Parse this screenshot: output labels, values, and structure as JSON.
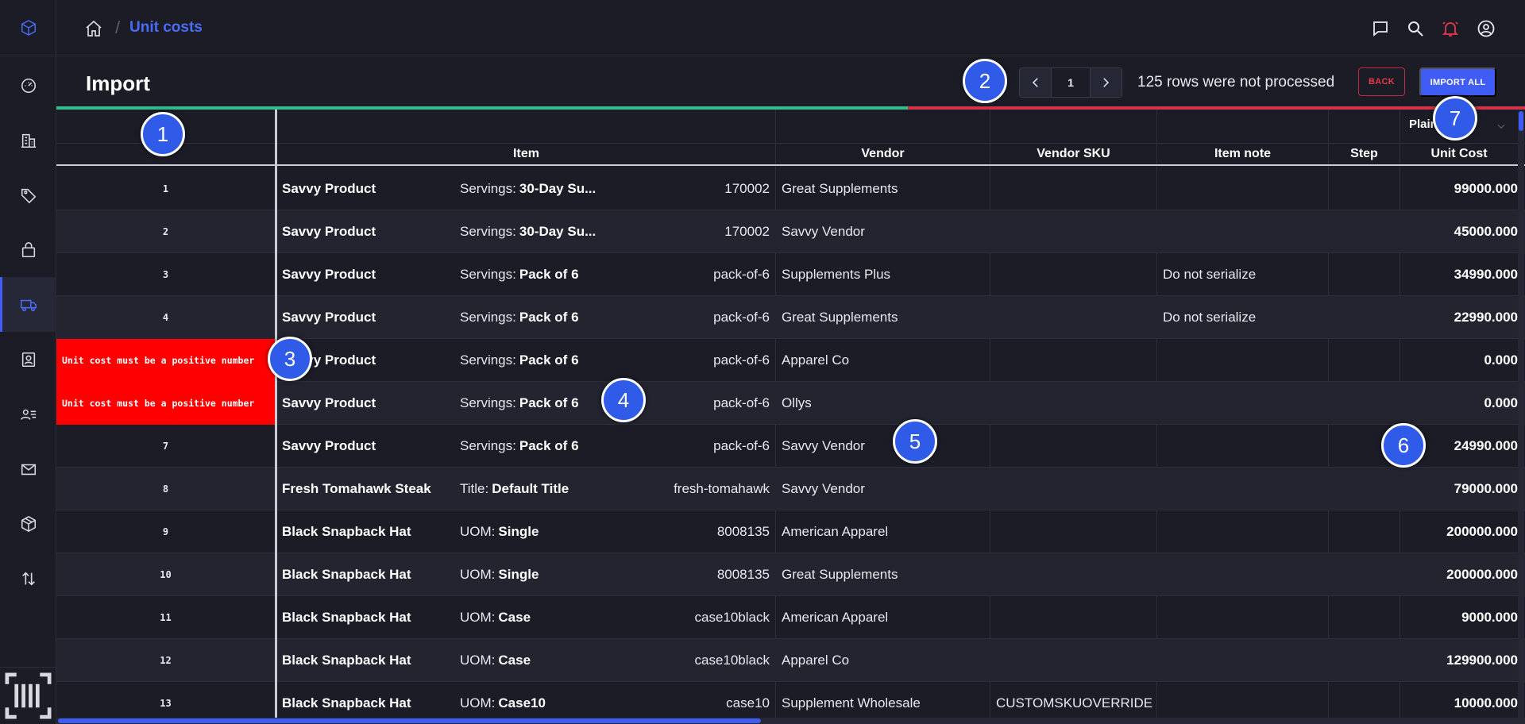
{
  "breadcrumb": {
    "current": "Unit costs",
    "separator": "/"
  },
  "header": {
    "title": "Import",
    "page_number": "1",
    "rows_message": "125 rows were not processed",
    "back_label": "BACK",
    "import_all_label": "IMPORT ALL",
    "progress_fraction": 0.58
  },
  "table": {
    "price_mode": "Plain",
    "columns": {
      "item": "Item",
      "vendor": "Vendor",
      "vendor_sku": "Vendor SKU",
      "item_note": "Item note",
      "step": "Step",
      "unit_cost": "Unit Cost"
    },
    "rows": [
      {
        "num": "1",
        "error": "",
        "name": "Savvy Product",
        "opt_label": "Servings:",
        "opt_value": "30-Day Su...",
        "sku": "170002",
        "vendor": "Great Supplements",
        "vendor_sku": "",
        "note": "",
        "cost": "99000.000"
      },
      {
        "num": "2",
        "error": "",
        "name": "Savvy Product",
        "opt_label": "Servings:",
        "opt_value": "30-Day Su...",
        "sku": "170002",
        "vendor": "Savvy Vendor",
        "vendor_sku": "",
        "note": "",
        "cost": "45000.000"
      },
      {
        "num": "3",
        "error": "",
        "name": "Savvy Product",
        "opt_label": "Servings:",
        "opt_value": "Pack of 6",
        "sku": "pack-of-6",
        "vendor": "Supplements Plus",
        "vendor_sku": "",
        "note": "Do not serialize",
        "cost": "34990.000"
      },
      {
        "num": "4",
        "error": "",
        "name": "Savvy Product",
        "opt_label": "Servings:",
        "opt_value": "Pack of 6",
        "sku": "pack-of-6",
        "vendor": "Great Supplements",
        "vendor_sku": "",
        "note": "Do not serialize",
        "cost": "22990.000"
      },
      {
        "num": "",
        "error": "Unit cost must be a positive number",
        "name": "Savvy Product",
        "opt_label": "Servings:",
        "opt_value": "Pack of 6",
        "sku": "pack-of-6",
        "vendor": "Apparel Co",
        "vendor_sku": "",
        "note": "",
        "cost": "0.000"
      },
      {
        "num": "",
        "error": "Unit cost must be a positive number",
        "name": "Savvy Product",
        "opt_label": "Servings:",
        "opt_value": "Pack of 6",
        "sku": "pack-of-6",
        "vendor": "Ollys",
        "vendor_sku": "",
        "note": "",
        "cost": "0.000"
      },
      {
        "num": "7",
        "error": "",
        "name": "Savvy Product",
        "opt_label": "Servings:",
        "opt_value": "Pack of 6",
        "sku": "pack-of-6",
        "vendor": "Savvy Vendor",
        "vendor_sku": "",
        "note": "",
        "cost": "24990.000"
      },
      {
        "num": "8",
        "error": "",
        "name": "Fresh Tomahawk Steak",
        "opt_label": "Title:",
        "opt_value": "Default Title",
        "sku": "fresh-tomahawk",
        "vendor": "Savvy Vendor",
        "vendor_sku": "",
        "note": "",
        "cost": "79000.000"
      },
      {
        "num": "9",
        "error": "",
        "name": "Black Snapback Hat",
        "opt_label": "UOM:",
        "opt_value": "Single",
        "sku": "8008135",
        "vendor": "American Apparel",
        "vendor_sku": "",
        "note": "",
        "cost": "200000.000"
      },
      {
        "num": "10",
        "error": "",
        "name": "Black Snapback Hat",
        "opt_label": "UOM:",
        "opt_value": "Single",
        "sku": "8008135",
        "vendor": "Great Supplements",
        "vendor_sku": "",
        "note": "",
        "cost": "200000.000"
      },
      {
        "num": "11",
        "error": "",
        "name": "Black Snapback Hat",
        "opt_label": "UOM:",
        "opt_value": "Case",
        "sku": "case10black",
        "vendor": "American Apparel",
        "vendor_sku": "",
        "note": "",
        "cost": "9000.000"
      },
      {
        "num": "12",
        "error": "",
        "name": "Black Snapback Hat",
        "opt_label": "UOM:",
        "opt_value": "Case",
        "sku": "case10black",
        "vendor": "Apparel Co",
        "vendor_sku": "",
        "note": "",
        "cost": "129900.000"
      },
      {
        "num": "13",
        "error": "",
        "name": "Black Snapback Hat",
        "opt_label": "UOM:",
        "opt_value": "Case10",
        "sku": "case10",
        "vendor": "Supplement Wholesale",
        "vendor_sku": "CUSTOMSKUOVERRIDE",
        "note": "",
        "cost": "10000.000"
      }
    ]
  },
  "markers": [
    "1",
    "2",
    "3",
    "4",
    "5",
    "6",
    "7"
  ],
  "colors": {
    "accent": "#3f5cf5",
    "error": "#ff0000",
    "success": "#2fbf8f",
    "danger": "#d4334a"
  },
  "icons": {
    "sidebar": [
      "logo-cube-icon",
      "dashboard-gauge-icon",
      "buildings-icon",
      "tag-icon",
      "shopping-bag-icon",
      "truck-icon",
      "contact-card-icon",
      "user-list-icon",
      "mail-send-icon",
      "package-box-icon",
      "transfer-arrows-icon",
      "barcode-scan-icon"
    ],
    "top": [
      "home-icon",
      "chat-icon",
      "search-icon",
      "bell-icon",
      "user-circle-icon"
    ]
  }
}
